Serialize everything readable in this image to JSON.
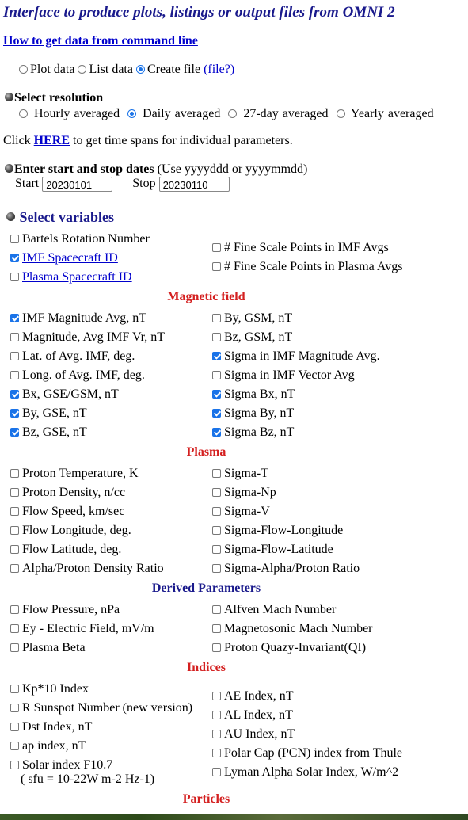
{
  "title": "Interface to produce plots, listings or output files from OMNI 2",
  "command_line_link": "How to get data from command line",
  "output_mode": {
    "options": [
      "Plot data",
      "List data",
      "Create file"
    ],
    "selected": "Create file",
    "help_link": "(file?)"
  },
  "resolution": {
    "heading": "Select resolution",
    "options": [
      "Hourly averaged",
      "Daily averaged",
      "27-day averaged",
      "Yearly averaged"
    ],
    "selected": "Daily averaged"
  },
  "timespan": {
    "prefix": "Click",
    "link": "HERE",
    "suffix": "to get time spans for individual parameters."
  },
  "dates": {
    "heading": "Enter start and stop dates",
    "hint": "(Use yyyyddd or yyyymmdd)",
    "start_label": "Start",
    "start_value": "20230101",
    "stop_label": "Stop",
    "stop_value": "20230110"
  },
  "variables_heading": "Select variables",
  "spacecraft": {
    "left": [
      {
        "label": "Bartels Rotation Number",
        "checked": false,
        "link": false
      },
      {
        "label": "IMF Spacecraft ID",
        "checked": true,
        "link": true
      },
      {
        "label": "Plasma Spacecraft ID",
        "checked": false,
        "link": true
      }
    ],
    "right": [
      {
        "label": "# Fine Scale Points in IMF Avgs",
        "checked": false
      },
      {
        "label": "# Fine Scale Points in Plasma Avgs",
        "checked": false
      }
    ]
  },
  "sections": [
    {
      "title": "Magnetic field",
      "style": "red",
      "left": [
        {
          "label": "IMF Magnitude Avg, nT",
          "checked": true
        },
        {
          "label": "Magnitude, Avg IMF Vr, nT",
          "checked": false
        },
        {
          "label": "Lat. of Avg. IMF, deg.",
          "checked": false
        },
        {
          "label": "Long. of Avg. IMF, deg.",
          "checked": false
        },
        {
          "label": "Bx, GSE/GSM, nT",
          "checked": true
        },
        {
          "label": "By, GSE, nT",
          "checked": true
        },
        {
          "label": "Bz, GSE, nT",
          "checked": true
        }
      ],
      "right": [
        {
          "label": "By, GSM, nT",
          "checked": false
        },
        {
          "label": "Bz, GSM, nT",
          "checked": false
        },
        {
          "label": "Sigma in IMF Magnitude Avg.",
          "checked": true
        },
        {
          "label": "Sigma in IMF Vector Avg",
          "checked": false
        },
        {
          "label": "Sigma Bx, nT",
          "checked": true
        },
        {
          "label": "Sigma By, nT",
          "checked": true
        },
        {
          "label": "Sigma Bz, nT",
          "checked": true
        }
      ]
    },
    {
      "title": "Plasma",
      "style": "red",
      "left": [
        {
          "label": "Proton Temperature, K",
          "checked": false
        },
        {
          "label": "Proton Density, n/cc",
          "checked": false
        },
        {
          "label": "Flow Speed, km/sec",
          "checked": false
        },
        {
          "label": "Flow Longitude, deg.",
          "checked": false
        },
        {
          "label": "Flow Latitude, deg.",
          "checked": false
        },
        {
          "label": "Alpha/Proton Density Ratio",
          "checked": false
        }
      ],
      "right": [
        {
          "label": "Sigma-T",
          "checked": false
        },
        {
          "label": "Sigma-Np",
          "checked": false
        },
        {
          "label": "Sigma-V",
          "checked": false
        },
        {
          "label": "Sigma-Flow-Longitude",
          "checked": false
        },
        {
          "label": "Sigma-Flow-Latitude",
          "checked": false
        },
        {
          "label": "Sigma-Alpha/Proton Ratio",
          "checked": false
        }
      ]
    },
    {
      "title": "Derived Parameters",
      "style": "blue",
      "left": [
        {
          "label": "Flow Pressure, nPa",
          "checked": false
        },
        {
          "label": "Ey - Electric Field, mV/m",
          "checked": false
        },
        {
          "label": "Plasma Beta",
          "checked": false
        }
      ],
      "right": [
        {
          "label": "Alfven Mach Number",
          "checked": false
        },
        {
          "label": "Magnetosonic Mach Number",
          "checked": false
        },
        {
          "label": "Proton Quazy-Invariant(QI)",
          "checked": false
        }
      ]
    }
  ],
  "indices": {
    "title": "Indices",
    "left": [
      {
        "label": "Kp*10 Index",
        "checked": false
      },
      {
        "label": "R Sunspot Number (new version)",
        "checked": false
      },
      {
        "label": "Dst Index, nT",
        "checked": false
      },
      {
        "label": "ap index, nT",
        "checked": false
      },
      {
        "label": "Solar index F10.7",
        "checked": false
      }
    ],
    "solar_note": "( sfu = 10-22W m-2 Hz-1)",
    "right": [
      {
        "label": "AE Index, nT",
        "checked": false
      },
      {
        "label": "AL Index, nT",
        "checked": false
      },
      {
        "label": "AU Index, nT",
        "checked": false
      },
      {
        "label": "Polar Cap (PCN) index from Thule",
        "checked": false
      },
      {
        "label": "Lyman Alpha Solar Index, W/m^2",
        "checked": false
      }
    ]
  },
  "particles_title": "Particles",
  "colors": {
    "title": "#1a1a8c",
    "link": "#0000cc",
    "section_red": "#d42020",
    "checkbox_accent": "#1a73e8"
  }
}
